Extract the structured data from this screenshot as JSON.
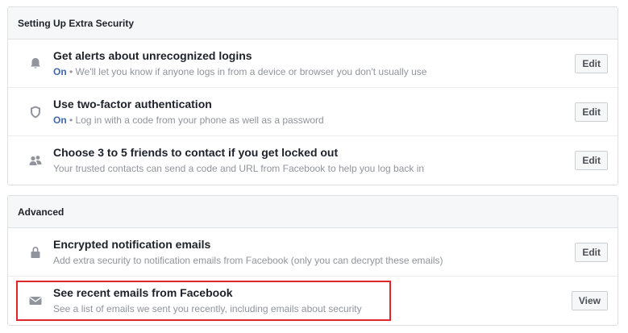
{
  "security": {
    "header": "Setting Up Extra Security",
    "rows": [
      {
        "title": "Get alerts about unrecognized logins",
        "status": "On",
        "desc": " • We'll let you know if anyone logs in from a device or browser you don't usually use",
        "button": "Edit",
        "icon": "bell-icon"
      },
      {
        "title": "Use two-factor authentication",
        "status": "On",
        "desc": " • Log in with a code from your phone as well as a password",
        "button": "Edit",
        "icon": "shield-icon"
      },
      {
        "title": "Choose 3 to 5 friends to contact if you get locked out",
        "desc": "Your trusted contacts can send a code and URL from Facebook to help you log back in",
        "button": "Edit",
        "icon": "friends-icon"
      }
    ]
  },
  "advanced": {
    "header": "Advanced",
    "rows": [
      {
        "title": "Encrypted notification emails",
        "desc": "Add extra security to notification emails from Facebook (only you can decrypt these emails)",
        "button": "Edit",
        "icon": "lock-icon"
      },
      {
        "title": "See recent emails from Facebook",
        "desc": "See a list of emails we sent you recently, including emails about security",
        "button": "View",
        "icon": "envelope-icon"
      }
    ]
  },
  "colors": {
    "status_on": "#4267b2",
    "highlight": "#e0262b",
    "icon": "#90949c"
  }
}
